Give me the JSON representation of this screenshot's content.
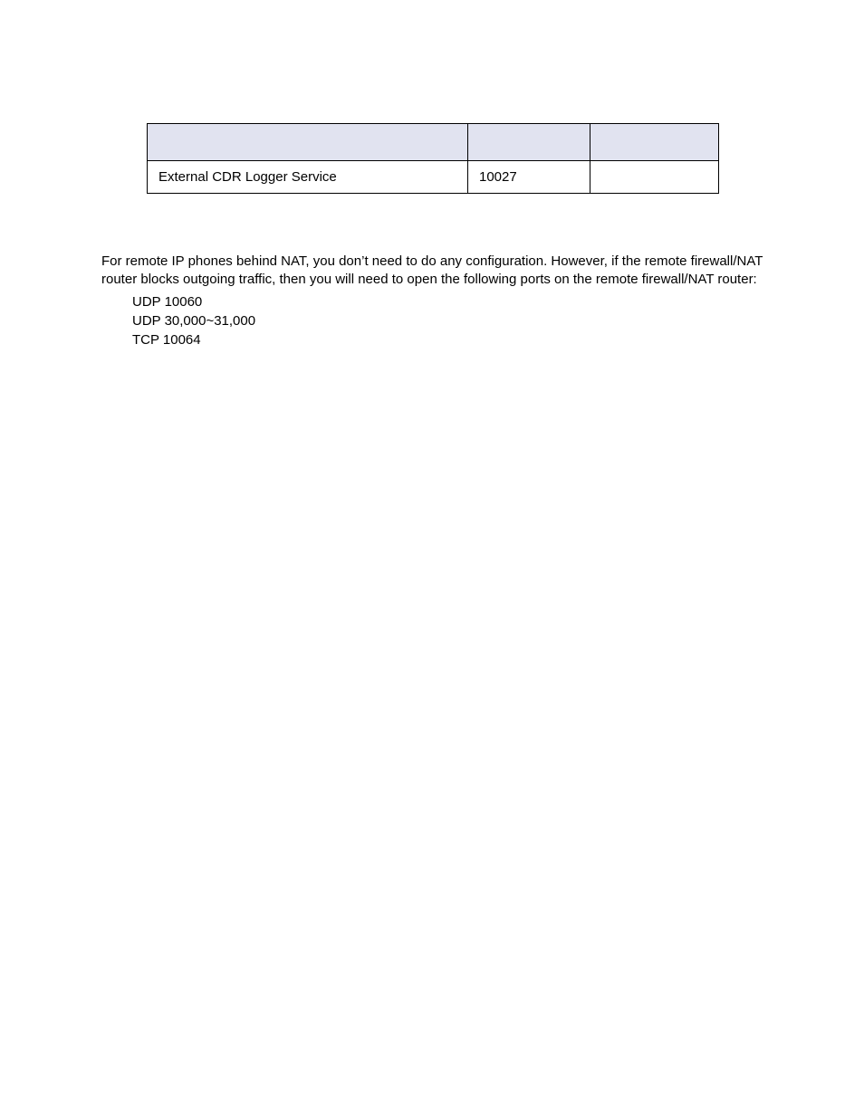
{
  "table": {
    "row": {
      "service": "External CDR Logger Service",
      "port": "10027",
      "extra": ""
    }
  },
  "paragraph": "For remote IP phones behind NAT, you don’t need to do any configuration. However, if the remote firewall/NAT router blocks outgoing traffic, then you will need to open the following ports on the remote firewall/NAT router:",
  "ports": {
    "p1": "UDP 10060",
    "p2": "UDP 30,000~31,000",
    "p3": "TCP 10064"
  }
}
